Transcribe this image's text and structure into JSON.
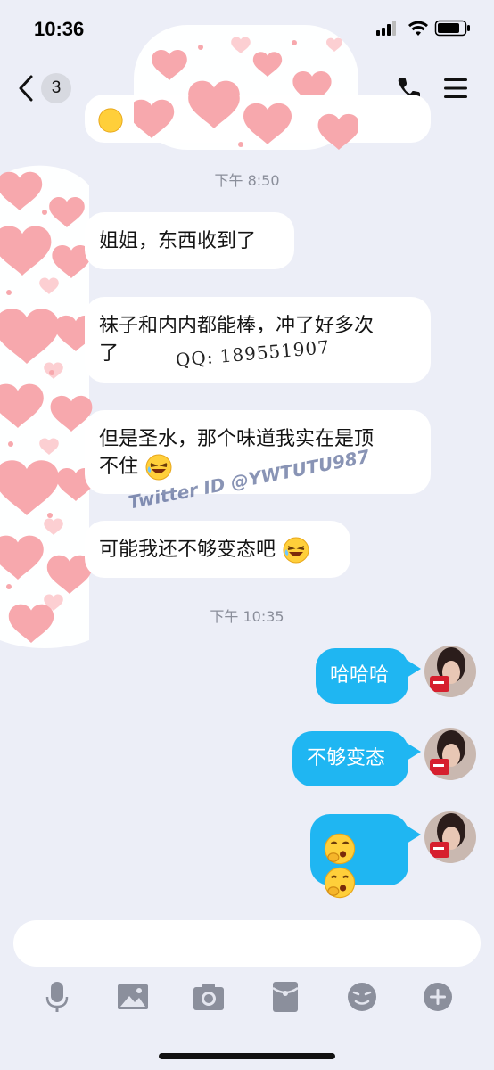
{
  "status_bar": {
    "time": "10:36"
  },
  "nav": {
    "unread_count": "3"
  },
  "messages_top": {
    "timestamp": "下午 8:50"
  },
  "incoming": [
    {
      "text": "姐姐，东西收到了"
    },
    {
      "line1": "袜子和内内都能棒，冲了好多次",
      "line2": "了"
    },
    {
      "line1": "但是圣水，那个味道我实在是顶",
      "line2": "不住"
    },
    {
      "text": "可能我还不够变态吧"
    }
  ],
  "messages_mid": {
    "timestamp": "下午 10:35"
  },
  "outgoing": [
    {
      "text": "哈哈哈"
    },
    {
      "text": "不够变态"
    },
    {
      "text": ""
    }
  ],
  "watermarks": {
    "qq": "QQ:  189551907",
    "twitter": "Twitter ID @YWTUTU987"
  },
  "input": {
    "value": "",
    "placeholder": ""
  },
  "colors": {
    "outgoing_bubble": "#1fb6f2",
    "incoming_bubble": "#ffffff",
    "background": "#eceef7",
    "icon_gray": "#8b8f9c"
  },
  "icons": [
    "microphone-icon",
    "image-icon",
    "camera-icon",
    "red-packet-icon",
    "emoji-icon",
    "plus-icon"
  ]
}
